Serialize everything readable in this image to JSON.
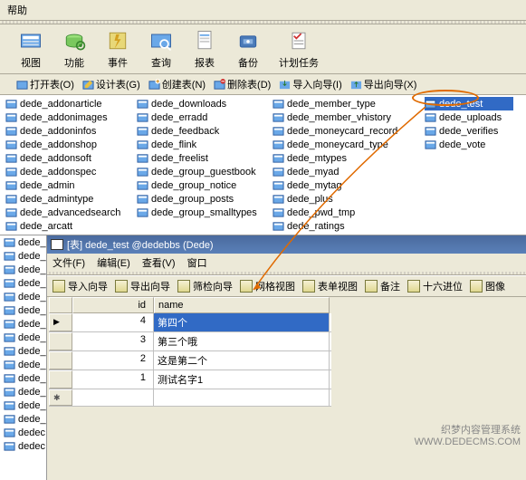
{
  "menu": {
    "help": "帮助"
  },
  "toolbar": [
    {
      "name": "view",
      "label": "视图"
    },
    {
      "name": "func",
      "label": "功能"
    },
    {
      "name": "event",
      "label": "事件"
    },
    {
      "name": "query",
      "label": "查询"
    },
    {
      "name": "report",
      "label": "报表"
    },
    {
      "name": "backup",
      "label": "备份"
    },
    {
      "name": "schedule",
      "label": "计划任务"
    }
  ],
  "actions": {
    "open": "打开表(O)",
    "design": "设计表(G)",
    "create": "创建表(N)",
    "delete": "删除表(D)",
    "import": "导入向导(I)",
    "export": "导出向导(X)"
  },
  "tables": {
    "c1": [
      "dede_addonarticle",
      "dede_addonimages",
      "dede_addoninfos",
      "dede_addonshop",
      "dede_addonsoft",
      "dede_addonspec",
      "dede_admin",
      "dede_admintype",
      "dede_advancedsearch",
      "dede_arcatt"
    ],
    "c2": [
      "dede_downloads",
      "dede_erradd",
      "dede_feedback",
      "dede_flink",
      "dede_freelist",
      "dede_group_guestbook",
      "dede_group_notice",
      "dede_group_posts",
      "dede_group_smalltypes"
    ],
    "c3": [
      "dede_member_type",
      "dede_member_vhistory",
      "dede_moneycard_record",
      "dede_moneycard_type",
      "dede_mtypes",
      "dede_myad",
      "dede_mytag",
      "dede_plus",
      "dede_pwd_tmp",
      "dede_ratings"
    ],
    "c4": [
      "dede_test",
      "dede_uploads",
      "dede_verifies",
      "dede_vote"
    ]
  },
  "side": [
    "dede_",
    "dede_",
    "dede_",
    "dede_",
    "dede_",
    "dede_",
    "dede_",
    "dede_",
    "dede_",
    "dede_",
    "dede_",
    "dede_",
    "dede_",
    "dede_",
    "dedec",
    "dedec"
  ],
  "child": {
    "title": "[表] dede_test @dedebbs (Dede)",
    "menu": {
      "file": "文件(F)",
      "edit": "编辑(E)",
      "view": "查看(V)",
      "window": "窗口"
    },
    "tool": {
      "import": "导入向导",
      "export": "导出向导",
      "filter": "筛检向导",
      "gridview": "网格视图",
      "formview": "表单视图",
      "memo": "备注",
      "hex": "十六进位",
      "image": "图像"
    }
  },
  "grid": {
    "hdr": {
      "id": "id",
      "name": "name"
    },
    "rows": [
      {
        "id": "4",
        "name": "第四个"
      },
      {
        "id": "3",
        "name": "第三个哦"
      },
      {
        "id": "2",
        "name": "这是第二个"
      },
      {
        "id": "1",
        "name": "测试名字1"
      }
    ]
  },
  "watermark": {
    "l1": "织梦内容管理系统",
    "l2": "WWW.DEDECMS.COM"
  }
}
